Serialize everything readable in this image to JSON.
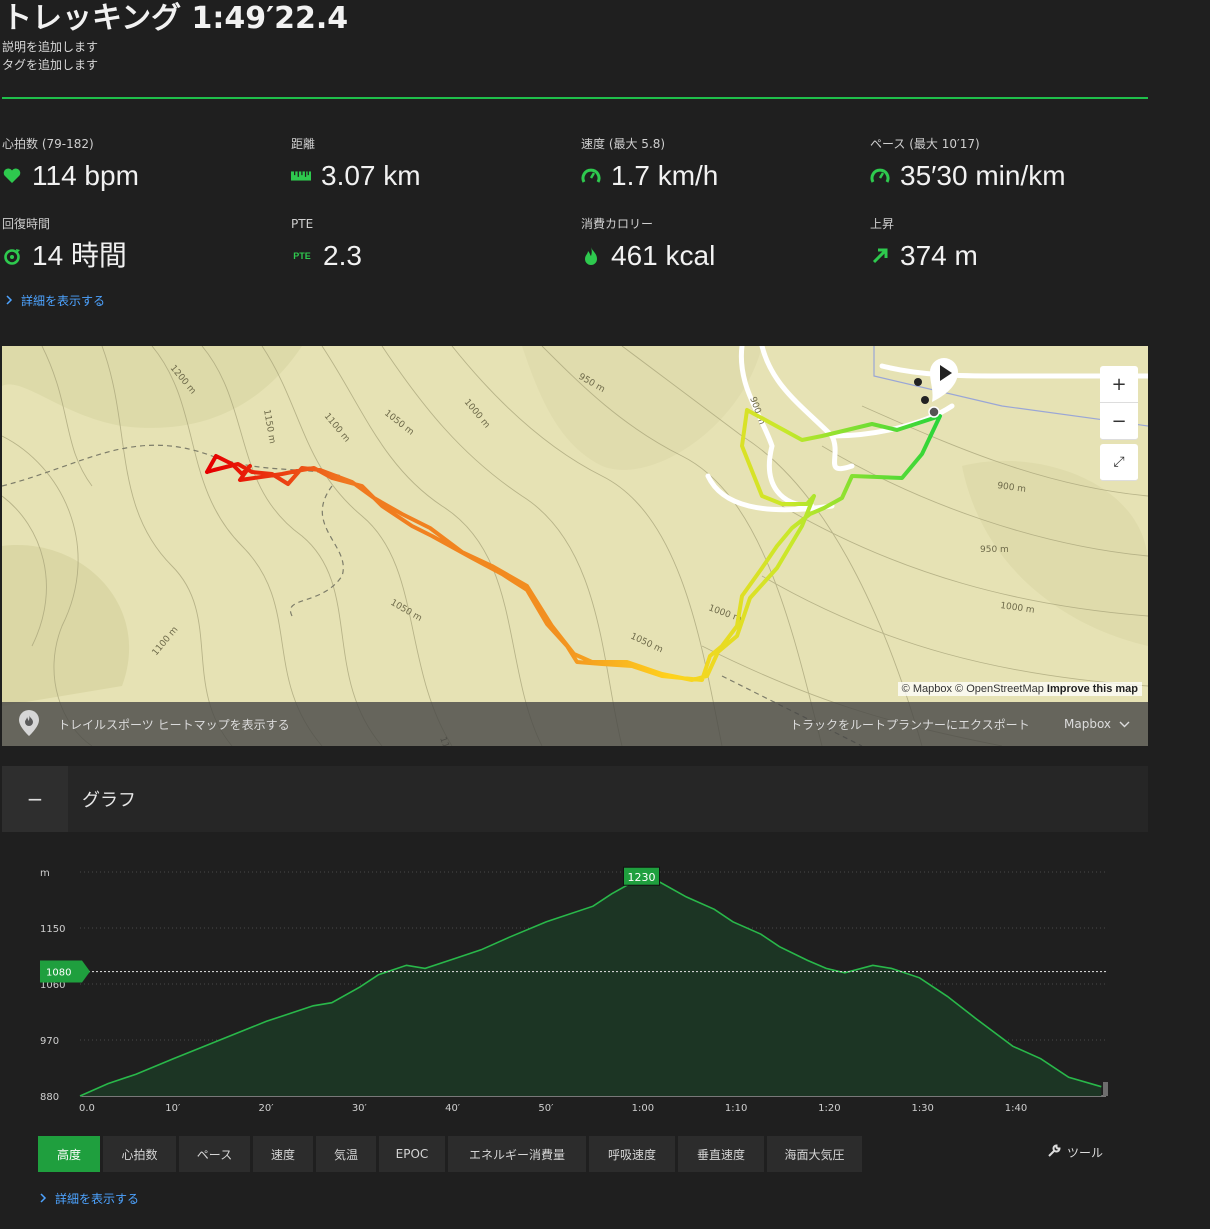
{
  "activity": {
    "title": "トレッキング 1:49′22.4",
    "add_description": "説明を追加します",
    "add_tags": "タグを追加します"
  },
  "stats": [
    {
      "label": "心拍数 (79-182)",
      "value": "114 bpm",
      "icon": "heart-icon"
    },
    {
      "label": "距離",
      "value": "3.07 km",
      "icon": "ruler-icon"
    },
    {
      "label": "速度 (最大  5.8)",
      "value": "1.7 km/h",
      "icon": "speedometer-icon"
    },
    {
      "label": "ペース (最大  10′17)",
      "value": "35′30 min/km",
      "icon": "speedometer-icon"
    },
    {
      "label": "回復時間",
      "value": "14 時間",
      "icon": "recovery-icon"
    },
    {
      "label": "PTE",
      "value": "2.3",
      "icon": "pte-icon",
      "icon_text": "PTE"
    },
    {
      "label": "消費カロリー",
      "value": "461 kcal",
      "icon": "flame-icon"
    },
    {
      "label": "上昇",
      "value": "374 m",
      "icon": "arrow-up-right-icon"
    }
  ],
  "details_link": "詳細を表示する",
  "map": {
    "contour_labels": [
      "1200 m",
      "1150 m",
      "1100 m",
      "1050 m",
      "1000 m",
      "950 m",
      "900 m",
      "900 m",
      "950 m",
      "1000 m",
      "1000 m",
      "1050 m",
      "1050 m",
      "1100 m",
      "1100",
      "1000"
    ],
    "zoom_in": "+",
    "zoom_out": "−",
    "fullscreen": "⤢",
    "attribution_mapbox": "© Mapbox",
    "attribution_osm": "© OpenStreetMap",
    "attribution_improve": "Improve this map",
    "heatmap_label": "トレイルスポーツ ヒートマップを表示する",
    "export_label": "トラックをルートプランナーにエクスポート",
    "style_label": "Mapbox",
    "colors": {
      "land": "#e6e2b4",
      "track_start": "#e60000",
      "track_mid": "#ffd21e",
      "track_end": "#23d43a"
    }
  },
  "graph": {
    "collapse_icon": "−",
    "title": "グラフ",
    "tools_label": "ツール",
    "tabs": [
      "高度",
      "心拍数",
      "ペース",
      "速度",
      "気温",
      "EPOC",
      "エネルギー消費量",
      "呼吸速度",
      "垂直速度",
      "海面大気圧"
    ],
    "active_tab": 0
  },
  "chart_data": {
    "type": "area",
    "ylabel": "m",
    "ylim": [
      880,
      1240
    ],
    "yticks": [
      880,
      970,
      1060,
      1150
    ],
    "ytick_labels": [
      "880",
      "970",
      "1060",
      "1150"
    ],
    "xlim": [
      0,
      110
    ],
    "xticks": [
      0,
      10,
      20,
      30,
      40,
      50,
      60,
      70,
      80,
      90,
      100
    ],
    "xtick_labels": [
      "0.0",
      "10′",
      "20′",
      "30′",
      "40′",
      "50′",
      "1:00",
      "1:10",
      "1:20",
      "1:30",
      "1:40"
    ],
    "reference_line": {
      "value": 1080,
      "label": "1080"
    },
    "max_marker": {
      "x": 60.2,
      "value": 1230,
      "label": "1230"
    },
    "x": [
      0,
      3,
      6,
      10,
      15,
      20,
      25,
      27,
      30,
      32,
      35,
      37,
      40,
      43,
      46,
      50,
      55,
      57,
      60,
      62,
      65,
      68,
      70,
      73,
      75,
      78,
      80,
      82,
      85,
      87,
      90,
      93,
      96,
      100,
      103,
      106,
      109.5
    ],
    "values": [
      880,
      900,
      915,
      940,
      970,
      1000,
      1025,
      1030,
      1055,
      1075,
      1090,
      1085,
      1100,
      1115,
      1135,
      1160,
      1185,
      1205,
      1230,
      1225,
      1200,
      1180,
      1160,
      1140,
      1120,
      1098,
      1085,
      1078,
      1090,
      1085,
      1070,
      1040,
      1005,
      960,
      940,
      910,
      895
    ],
    "colors": {
      "line": "#29b84a",
      "fill": "#1c3524",
      "ref": "#cfcfcf",
      "badge": "#1f9f3e"
    }
  }
}
